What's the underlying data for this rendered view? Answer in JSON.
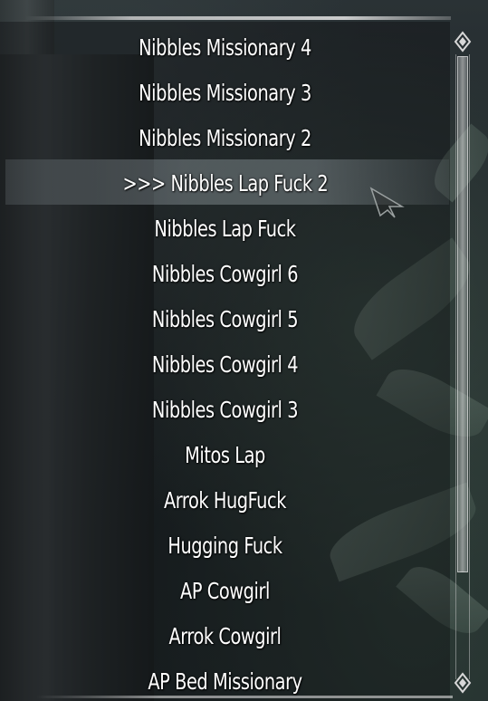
{
  "menu": {
    "items": [
      {
        "label": "Nibbles Missionary 4"
      },
      {
        "label": "Nibbles Missionary 3"
      },
      {
        "label": "Nibbles Missionary 2"
      },
      {
        "label": "Nibbles Lap Fuck 2",
        "selected": true
      },
      {
        "label": "Nibbles Lap Fuck"
      },
      {
        "label": "Nibbles Cowgirl 6"
      },
      {
        "label": "Nibbles Cowgirl 5"
      },
      {
        "label": "Nibbles Cowgirl 4"
      },
      {
        "label": "Nibbles Cowgirl 3"
      },
      {
        "label": "Mitos Lap"
      },
      {
        "label": "Arrok HugFuck"
      },
      {
        "label": "Hugging Fuck"
      },
      {
        "label": "AP Cowgirl"
      },
      {
        "label": "Arrok Cowgirl"
      },
      {
        "label": "AP Bed Missionary"
      }
    ],
    "selected_prefix": ">>> "
  },
  "icons": {
    "scroll_up": "scroll-up-arrow-icon",
    "scroll_down": "scroll-down-arrow-icon",
    "cursor": "mouse-cursor-icon"
  },
  "colors": {
    "text": "#ffffff",
    "highlight": "#8c969b"
  }
}
